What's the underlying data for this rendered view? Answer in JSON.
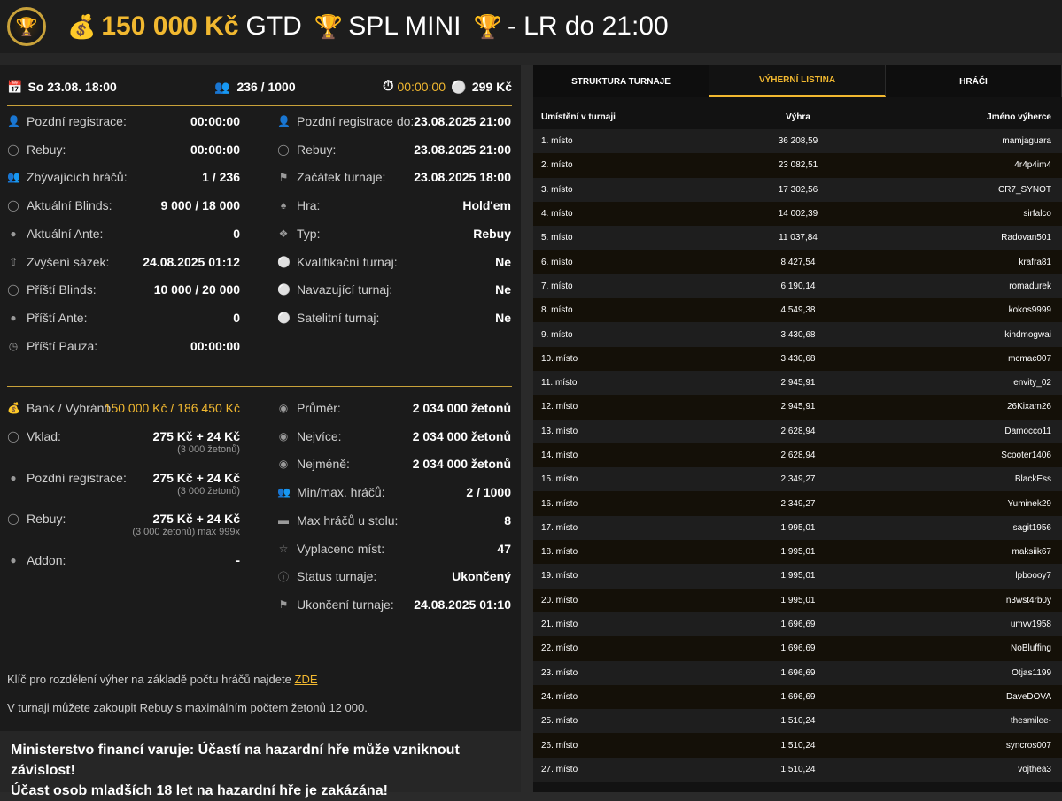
{
  "header": {
    "money_icon": "money-bag-icon",
    "amount": "150 000 Kč",
    "gtd": "GTD",
    "trophy_icon": "trophy-icon",
    "event": "SPL MINI",
    "suffix": "- LR do 21:00"
  },
  "summary": {
    "date": "So 23.08. 18:00",
    "players": "236 / 1000",
    "timer": "00:00:00",
    "buyin": "299 Kč"
  },
  "left_col": [
    {
      "icon": "user-icon",
      "label": "Pozdní registrace:",
      "value": "00:00:00"
    },
    {
      "icon": "chips-icon",
      "label": "Rebuy:",
      "value": "00:00:00"
    },
    {
      "icon": "users-icon",
      "label": "Zbývajících hráčů:",
      "value": "1 / 236"
    },
    {
      "icon": "chips-icon",
      "label": "Aktuální Blinds:",
      "value": "9 000 / 18 000"
    },
    {
      "icon": "coin-icon",
      "label": "Aktuální Ante:",
      "value": "0"
    },
    {
      "icon": "arrow-up-icon",
      "label": "Zvýšení sázek:",
      "value": "24.08.2025 01:12"
    },
    {
      "icon": "chips-icon",
      "label": "Příští Blinds:",
      "value": "10 000 / 20 000"
    },
    {
      "icon": "coin-icon",
      "label": "Příští Ante:",
      "value": "0"
    },
    {
      "icon": "clock-icon",
      "label": "Příští Pauza:",
      "value": "00:00:00"
    }
  ],
  "right_col": [
    {
      "icon": "user-icon",
      "label": "Pozdní registrace do:",
      "value": "23.08.2025 21:00"
    },
    {
      "icon": "chips-icon",
      "label": "Rebuy:",
      "value": "23.08.2025 21:00"
    },
    {
      "icon": "flag-icon",
      "label": "Začátek turnaje:",
      "value": "23.08.2025 18:00"
    },
    {
      "icon": "cards-icon",
      "label": "Hra:",
      "value": "Hold'em"
    },
    {
      "icon": "grid-icon",
      "label": "Typ:",
      "value": "Rebuy"
    },
    {
      "icon": "medal-icon",
      "label": "Kvalifikační turnaj:",
      "value": "Ne"
    },
    {
      "icon": "medal-icon",
      "label": "Navazující turnaj:",
      "value": "Ne"
    },
    {
      "icon": "medal-icon",
      "label": "Satelitní turnaj:",
      "value": "Ne"
    }
  ],
  "bottom_left": [
    {
      "icon": "money-bag-icon",
      "label": "Bank / Vybráno:",
      "value": "150 000 Kč / 186 450 Kč",
      "gold": true,
      "sub": ""
    },
    {
      "icon": "chips-icon",
      "label": "Vklad:",
      "value": "275 Kč + 24 Kč",
      "sub": "(3 000 žetonů)"
    },
    {
      "icon": "coin-icon",
      "label": "Pozdní registrace:",
      "value": "275 Kč + 24 Kč",
      "sub": "(3 000 žetonů)"
    },
    {
      "icon": "chips-icon",
      "label": "Rebuy:",
      "value": "275 Kč + 24 Kč",
      "sub": "(3 000 žetonů) max 999x"
    },
    {
      "icon": "coin-icon",
      "label": "Addon:",
      "value": "-",
      "sub": ""
    }
  ],
  "bottom_right": [
    {
      "icon": "chip-icon",
      "label": "Průměr:",
      "value": "2 034 000 žetonů"
    },
    {
      "icon": "chip-icon",
      "label": "Nejvíce:",
      "value": "2 034 000 žetonů"
    },
    {
      "icon": "chip-icon",
      "label": "Nejméně:",
      "value": "2 034 000 žetonů"
    },
    {
      "icon": "users-icon",
      "label": "Min/max. hráčů:",
      "value": "2 / 1000"
    },
    {
      "icon": "table-icon",
      "label": "Max hráčů u stolu:",
      "value": "8"
    },
    {
      "icon": "payout-icon",
      "label": "Vyplaceno míst:",
      "value": "47"
    },
    {
      "icon": "info-icon",
      "label": "Status turnaje:",
      "value": "Ukončený"
    },
    {
      "icon": "flag-icon",
      "label": "Ukončení turnaje:",
      "value": "24.08.2025 01:10"
    }
  ],
  "notes": {
    "key_text": "Klíč pro rozdělení výher na základě počtu hráčů najdete",
    "key_link": "ZDE",
    "rebuy_text": "V turnaji můžete zakoupit Rebuy s maximálním počtem žetonů 12 000."
  },
  "warning": {
    "line1": "Ministerstvo financí varuje: Účastí na hazardní hře může vzniknout závislost!",
    "line2": "Účast osob mladších 18 let na hazardní hře je zakázána!"
  },
  "tabs": [
    "STRUKTURA TURNAJE",
    "VÝHERNÍ LISTINA",
    "HRÁČI"
  ],
  "table": {
    "headers": [
      "Umístění v turnaji",
      "Výhra",
      "Jméno výherce"
    ],
    "rows": [
      [
        "1. místo",
        "36 208,59",
        "mamjaguara"
      ],
      [
        "2. místo",
        "23 082,51",
        "4r4p4im4"
      ],
      [
        "3. místo",
        "17 302,56",
        "CR7_SYNOT"
      ],
      [
        "4. místo",
        "14 002,39",
        "sirfalco"
      ],
      [
        "5. místo",
        "11 037,84",
        "Radovan501"
      ],
      [
        "6. místo",
        "8 427,54",
        "krafra81"
      ],
      [
        "7. místo",
        "6 190,14",
        "romadurek"
      ],
      [
        "8. místo",
        "4 549,38",
        "kokos9999"
      ],
      [
        "9. místo",
        "3 430,68",
        "kindmogwai"
      ],
      [
        "10. místo",
        "3 430,68",
        "mcmac007"
      ],
      [
        "11. místo",
        "2 945,91",
        "envity_02"
      ],
      [
        "12. místo",
        "2 945,91",
        "26Kixam26"
      ],
      [
        "13. místo",
        "2 628,94",
        "Damocco11"
      ],
      [
        "14. místo",
        "2 628,94",
        "Scooter1406"
      ],
      [
        "15. místo",
        "2 349,27",
        "BlackEss"
      ],
      [
        "16. místo",
        "2 349,27",
        "Yuminek29"
      ],
      [
        "17. místo",
        "1 995,01",
        "sagit1956"
      ],
      [
        "18. místo",
        "1 995,01",
        "maksiik67"
      ],
      [
        "19. místo",
        "1 995,01",
        "lpboooy7"
      ],
      [
        "20. místo",
        "1 995,01",
        "n3wst4rb0y"
      ],
      [
        "21. místo",
        "1 696,69",
        "umvv1958"
      ],
      [
        "22. místo",
        "1 696,69",
        "NoBluffing"
      ],
      [
        "23. místo",
        "1 696,69",
        "Otjas1199"
      ],
      [
        "24. místo",
        "1 696,69",
        "DaveDOVA"
      ],
      [
        "25. místo",
        "1 510,24",
        "thesmilee-"
      ],
      [
        "26. místo",
        "1 510,24",
        "syncros007"
      ],
      [
        "27. místo",
        "1 510,24",
        "vojthea3"
      ]
    ]
  }
}
